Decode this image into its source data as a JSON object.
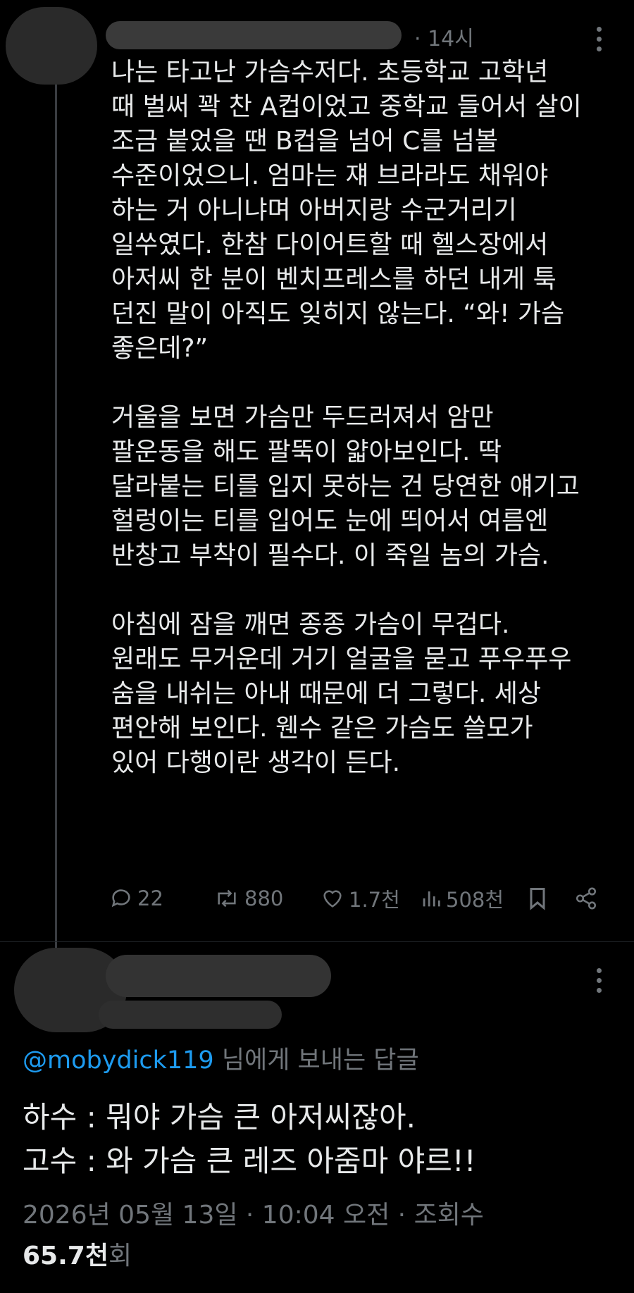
{
  "post": {
    "time": "· 14시",
    "paragraphs": [
      "나는 타고난 가슴수저다. 초등학교 고학년\n때 벌써 꽉 찬 A컵이었고 중학교 들어서 살이\n조금 붙었을 땐 B컵을 넘어 C를 넘볼\n수준이었으니. 엄마는 쟤 브라라도 채워야\n하는 거 아니냐며 아버지랑 수군거리기\n일쑤였다. 한참 다이어트할 때 헬스장에서\n아저씨 한 분이 벤치프레스를 하던 내게 툭\n던진 말이 아직도 잊히지 않는다. “와! 가슴\n좋은데?”",
      "거울을 보면 가슴만 두드러져서 암만\n팔운동을 해도 팔뚝이 얇아보인다. 딱\n달라붙는 티를 입지 못하는 건 당연한 얘기고\n헐렁이는 티를 입어도 눈에 띄어서 여름엔\n반창고 부착이 필수다. 이 죽일 놈의 가슴.",
      "아침에 잠을 깨면 종종 가슴이 무겁다.\n원래도 무거운데 거기 얼굴을 묻고 푸우푸우\n숨을 내쉬는 아내 때문에 더 그렇다. 세상\n편안해 보인다. 웬수 같은 가슴도 쓸모가\n있어 다행이란 생각이 든다."
    ],
    "actions": {
      "replies": "22",
      "reposts": "880",
      "likes": "1.7천",
      "views": "508천"
    }
  },
  "reply": {
    "handle": "@mobydick119",
    "reply_suffix": " 님에게 보내는 답글",
    "lines": [
      "하수 : 뭐야 가슴 큰 아저씨잖아.",
      "고수 : 와 가슴 큰 레즈 아줌마 야르!!"
    ],
    "meta": "2026년 05월 13일 · 10:04 오전 · 조회수",
    "views_count": "65.7천",
    "views_unit": "회"
  },
  "colors": {
    "background": "#000000",
    "text": "#e7e9ea",
    "muted": "#71767b",
    "link": "#1d9bf0"
  }
}
